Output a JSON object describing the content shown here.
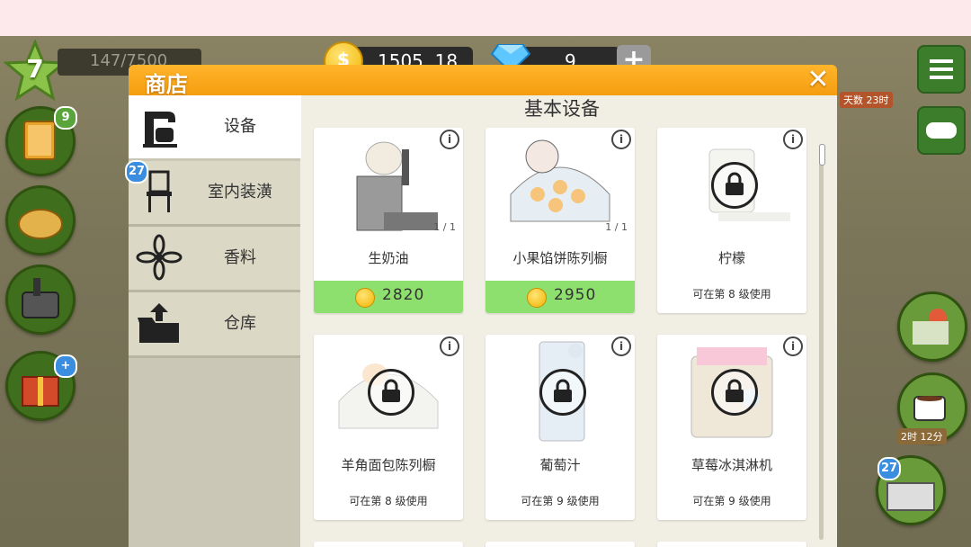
{
  "hud": {
    "level": "7",
    "xp": "147/7500",
    "coins": "1505 .18",
    "gems": "9",
    "plus": "+",
    "book_badge": "9",
    "register_badge": "27",
    "timer": "2时 12分",
    "gift_text": "天数 23时"
  },
  "dialog": {
    "title": "商店",
    "close": "✕"
  },
  "tabs": [
    {
      "label": "设备",
      "icon": "mixer-icon",
      "active": true
    },
    {
      "label": "室内装潢",
      "icon": "chair-icon",
      "badge": "27"
    },
    {
      "label": "香料",
      "icon": "anise-icon"
    },
    {
      "label": "仓库",
      "icon": "box-icon"
    }
  ],
  "content": {
    "section_title": "基本设备",
    "items": [
      {
        "name": "生奶油",
        "count": "1 / 1",
        "price": "2820",
        "locked": false
      },
      {
        "name": "小果馅饼陈列橱",
        "count": "1 / 1",
        "price": "2950",
        "locked": false
      },
      {
        "name": "柠檬",
        "unlock": "可在第 8 级使用",
        "locked": true
      },
      {
        "name": "羊角面包陈列橱",
        "unlock": "可在第 8 级使用",
        "locked": true
      },
      {
        "name": "葡萄汁",
        "unlock": "可在第 9 级使用",
        "locked": true
      },
      {
        "name": "草莓冰淇淋机",
        "unlock": "可在第 9 级使用",
        "locked": true
      }
    ]
  },
  "colors": {
    "header": "#f59d10",
    "price_bg": "#8ee06e",
    "tab_active": "#ffffff",
    "tab_inactive": "#dcd8c6"
  }
}
